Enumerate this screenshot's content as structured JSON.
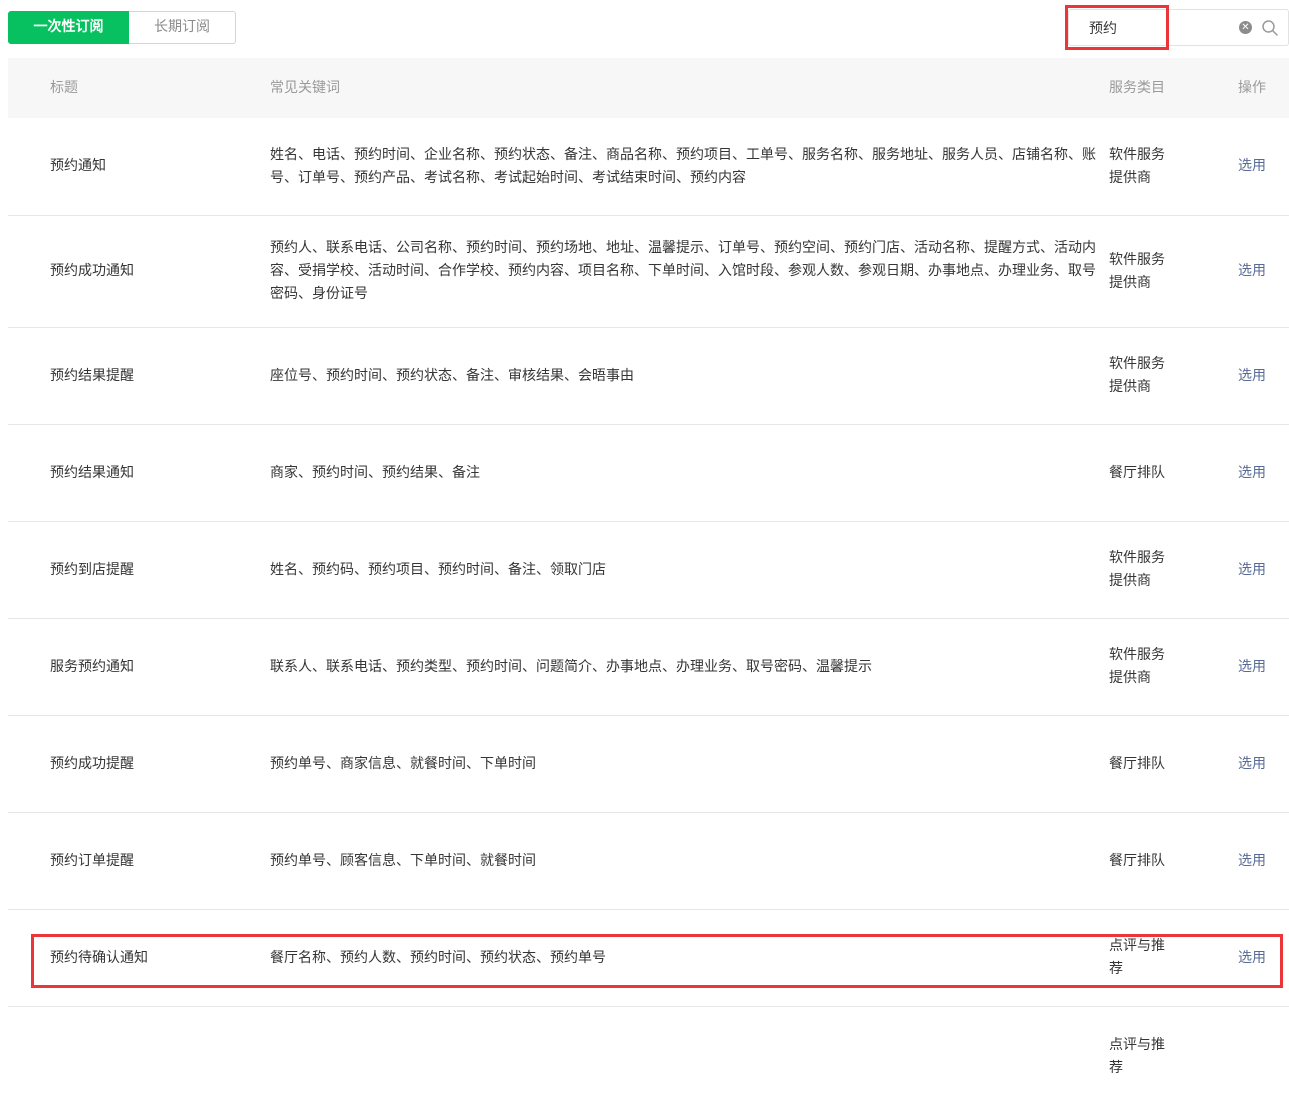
{
  "tabs": [
    {
      "label": "一次性订阅",
      "active": true
    },
    {
      "label": "长期订阅",
      "active": false
    }
  ],
  "search": {
    "value": "预约",
    "placeholder": ""
  },
  "table": {
    "headers": {
      "title": "标题",
      "keywords": "常见关键词",
      "category": "服务类目",
      "operation": "操作"
    },
    "rows": [
      {
        "title": "预约通知",
        "keywords": "姓名、电话、预约时间、企业名称、预约状态、备注、商品名称、预约项目、工单号、服务名称、服务地址、服务人员、店铺名称、账号、订单号、预约产品、考试名称、考试起始时间、考试结束时间、预约内容",
        "category": "软件服务提供商",
        "action": "选用"
      },
      {
        "title": "预约成功通知",
        "keywords": "预约人、联系电话、公司名称、预约时间、预约场地、地址、温馨提示、订单号、预约空间、预约门店、活动名称、提醒方式、活动内容、受捐学校、活动时间、合作学校、预约内容、项目名称、下单时间、入馆时段、参观人数、参观日期、办事地点、办理业务、取号密码、身份证号",
        "category": "软件服务提供商",
        "action": "选用"
      },
      {
        "title": "预约结果提醒",
        "keywords": "座位号、预约时间、预约状态、备注、审核结果、会晤事由",
        "category": "软件服务提供商",
        "action": "选用"
      },
      {
        "title": "预约结果通知",
        "keywords": "商家、预约时间、预约结果、备注",
        "category": "餐厅排队",
        "action": "选用"
      },
      {
        "title": "预约到店提醒",
        "keywords": "姓名、预约码、预约项目、预约时间、备注、领取门店",
        "category": "软件服务提供商",
        "action": "选用"
      },
      {
        "title": "服务预约通知",
        "keywords": "联系人、联系电话、预约类型、预约时间、问题简介、办事地点、办理业务、取号密码、温馨提示",
        "category": "软件服务提供商",
        "action": "选用"
      },
      {
        "title": "预约成功提醒",
        "keywords": "预约单号、商家信息、就餐时间、下单时间",
        "category": "餐厅排队",
        "action": "选用"
      },
      {
        "title": "预约订单提醒",
        "keywords": "预约单号、顾客信息、下单时间、就餐时间",
        "category": "餐厅排队",
        "action": "选用"
      },
      {
        "title": "预约待确认通知",
        "keywords": "餐厅名称、预约人数、预约时间、预约状态、预约单号",
        "category": "点评与推荐",
        "action": "选用"
      },
      {
        "title": "",
        "keywords": "",
        "category": "点评与推荐",
        "action": ""
      }
    ]
  },
  "colors": {
    "primary": "#07c160",
    "link": "#576b95",
    "highlight": "#ea3539",
    "header_bg": "#f7f7f7"
  }
}
